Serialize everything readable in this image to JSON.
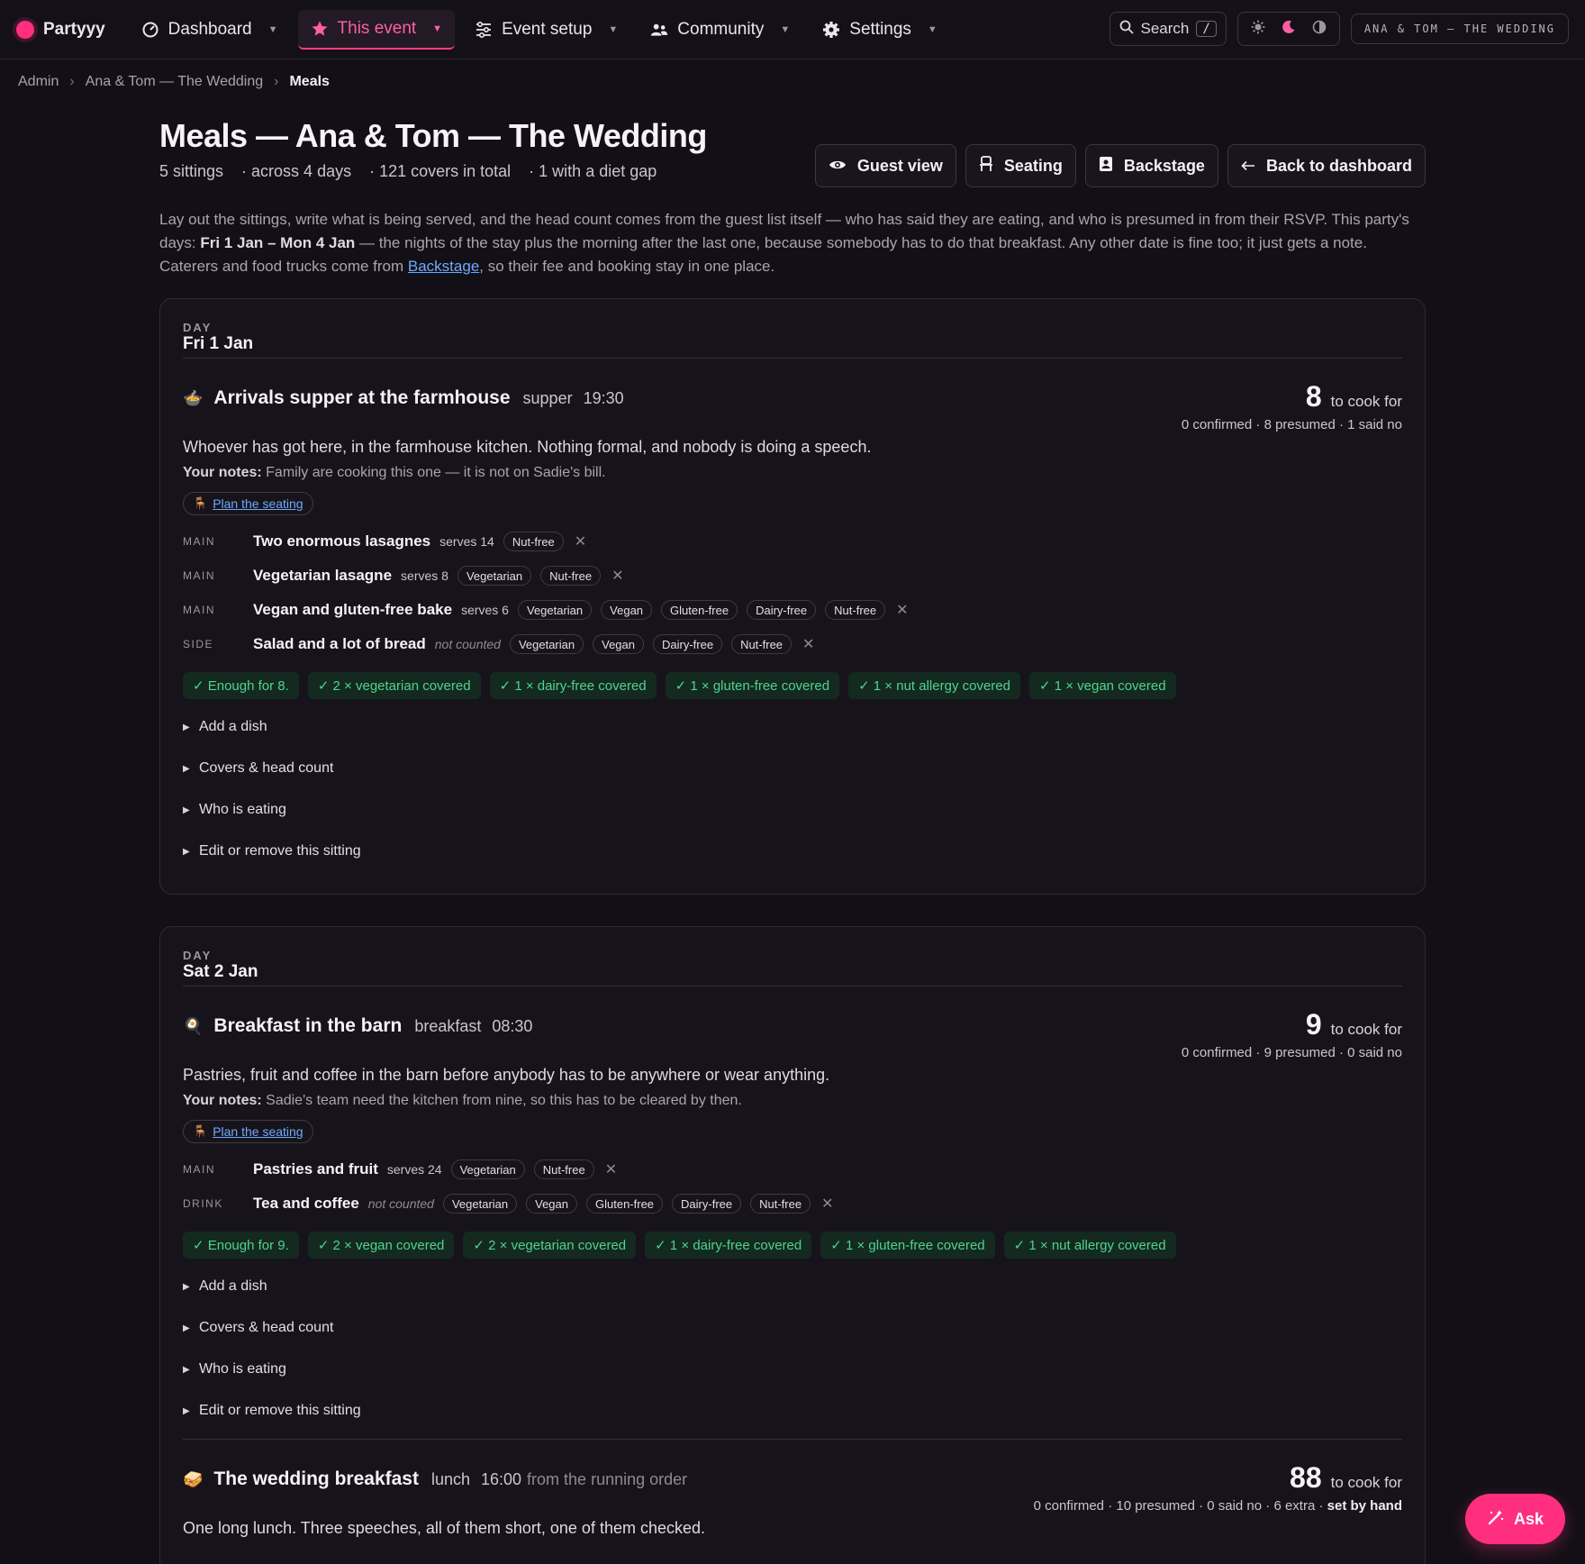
{
  "app": {
    "brand": "Partyyy"
  },
  "nav": {
    "items": [
      {
        "label": "Dashboard",
        "icon": "dashboard-icon"
      },
      {
        "label": "This event",
        "icon": "star-icon"
      },
      {
        "label": "Event setup",
        "icon": "sliders-icon"
      },
      {
        "label": "Community",
        "icon": "people-icon"
      },
      {
        "label": "Settings",
        "icon": "gear-icon"
      }
    ],
    "search_label": "Search",
    "search_shortcut": "/",
    "event_chip": "ANA & TOM — THE WEDDING",
    "accent_color": "#ff2e7e"
  },
  "breadcrumb": {
    "root": "Admin",
    "event": "Ana & Tom — The Wedding",
    "current": "Meals"
  },
  "header": {
    "title": "Meals — Ana & Tom — The Wedding",
    "meta": [
      "5 sittings",
      "· across 4 days",
      "· 121 covers in total",
      "· 1 with a diet gap"
    ],
    "actions": {
      "guest_view": "Guest view",
      "seating": "Seating",
      "backstage": "Backstage",
      "back": "Back to dashboard"
    }
  },
  "intro": {
    "p1": "Lay out the sittings, write what is being served, and the head count comes from the guest list itself — who has said they are eating, and who is presumed in from their RSVP. This party's days: ",
    "dates": "Fri 1 Jan – Mon 4 Jan",
    "p2": " — the nights of the stay plus the morning after the last one, because somebody has to do that breakfast. Any other date is fine too; it just gets a note. Caterers and food trucks come from ",
    "link": "Backstage",
    "p3": ", so their fee and booking stay in one place."
  },
  "days": [
    {
      "label": "DAY",
      "name": "Fri 1 Jan",
      "sittings": [
        {
          "emoji": "🍲",
          "title": "Arrivals supper at the farmhouse",
          "kind": "supper",
          "time": "19:30",
          "count": "8",
          "count_unit": "to cook for",
          "count_sub": "0 confirmed · 8 presumed · 1 said no",
          "desc": "Whoever has got here, in the farmhouse kitchen. Nothing formal, and nobody is doing a speech.",
          "notes_label": "Your notes:",
          "notes": "Family are cooking this one — it is not on Sadie's bill.",
          "plan_link": "Plan the seating",
          "dishes": [
            {
              "course": "MAIN",
              "name": "Two enormous lasagnes",
              "serves": "serves 14",
              "tags": [
                "Nut-free"
              ]
            },
            {
              "course": "MAIN",
              "name": "Vegetarian lasagne",
              "serves": "serves 8",
              "tags": [
                "Vegetarian",
                "Nut-free"
              ]
            },
            {
              "course": "MAIN",
              "name": "Vegan and gluten-free bake",
              "serves": "serves 6",
              "tags": [
                "Vegetarian",
                "Vegan",
                "Gluten-free",
                "Dairy-free",
                "Nut-free"
              ]
            },
            {
              "course": "SIDE",
              "name": "Salad and a lot of bread",
              "serves": "not counted",
              "tags": [
                "Vegetarian",
                "Vegan",
                "Dairy-free",
                "Nut-free"
              ]
            }
          ],
          "covers": [
            "✓ Enough for 8.",
            "✓ 2 × vegetarian covered",
            "✓ 1 × dairy-free covered",
            "✓ 1 × gluten-free covered",
            "✓ 1 × nut allergy covered",
            "✓ 1 × vegan covered"
          ],
          "toggles": [
            "Add a dish",
            "Covers & head count",
            "Who is eating",
            "Edit or remove this sitting"
          ]
        }
      ]
    },
    {
      "label": "DAY",
      "name": "Sat 2 Jan",
      "sittings": [
        {
          "emoji": "🍳",
          "title": "Breakfast in the barn",
          "kind": "breakfast",
          "time": "08:30",
          "count": "9",
          "count_unit": "to cook for",
          "count_sub": "0 confirmed · 9 presumed · 0 said no",
          "desc": "Pastries, fruit and coffee in the barn before anybody has to be anywhere or wear anything.",
          "notes_label": "Your notes:",
          "notes": "Sadie's team need the kitchen from nine, so this has to be cleared by then.",
          "plan_link": "Plan the seating",
          "dishes": [
            {
              "course": "MAIN",
              "name": "Pastries and fruit",
              "serves": "serves 24",
              "tags": [
                "Vegetarian",
                "Nut-free"
              ]
            },
            {
              "course": "DRINK",
              "name": "Tea and coffee",
              "serves": "not counted",
              "tags": [
                "Vegetarian",
                "Vegan",
                "Gluten-free",
                "Dairy-free",
                "Nut-free"
              ]
            }
          ],
          "covers": [
            "✓ Enough for 9.",
            "✓ 2 × vegan covered",
            "✓ 2 × vegetarian covered",
            "✓ 1 × dairy-free covered",
            "✓ 1 × gluten-free covered",
            "✓ 1 × nut allergy covered"
          ],
          "toggles": [
            "Add a dish",
            "Covers & head count",
            "Who is eating",
            "Edit or remove this sitting"
          ]
        },
        {
          "emoji": "🥪",
          "title": "The wedding breakfast",
          "kind": "lunch",
          "time": "16:00",
          "time_source": "from the running order",
          "count": "88",
          "count_unit": "to cook for",
          "count_sub": "0 confirmed · 10 presumed · 0 said no · 6 extra · ",
          "count_sub_strong": "set by hand",
          "desc": "One long lunch. Three speeches, all of them short, one of them checked."
        }
      ]
    }
  ],
  "ask_button": "Ask"
}
